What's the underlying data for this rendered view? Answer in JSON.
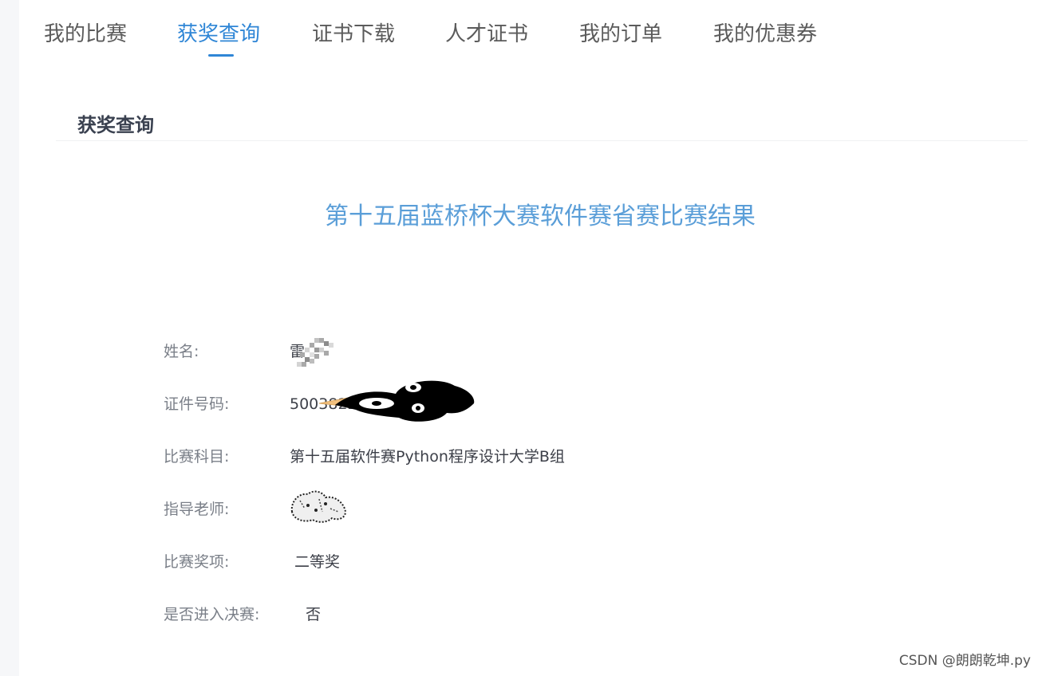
{
  "tabs": [
    {
      "label": "我的比赛"
    },
    {
      "label": "获奖查询"
    },
    {
      "label": "证书下载"
    },
    {
      "label": "人才证书"
    },
    {
      "label": "我的订单"
    },
    {
      "label": "我的优惠券"
    }
  ],
  "active_tab": "获奖查询",
  "section": {
    "title": "获奖查询"
  },
  "result": {
    "title": "第十五届蓝桥杯大赛软件赛省赛比赛结果",
    "rows": [
      {
        "label": "姓名:",
        "value": "雷"
      },
      {
        "label": "证件号码:",
        "value": "500382200"
      },
      {
        "label": "比赛科目:",
        "value": "第十五届软件赛Python程序设计大学B组"
      },
      {
        "label": "指导老师:",
        "value": ""
      },
      {
        "label": "比赛奖项:",
        "value": "二等奖"
      },
      {
        "label": "是否进入决赛:",
        "value": "否"
      }
    ]
  },
  "watermark": "CSDN @朗朗乾坤.py",
  "colors": {
    "accent": "#2f86d6",
    "title_blue": "#5a9ed8",
    "label_gray": "#7a7f88",
    "text_dark": "#3d4049"
  }
}
